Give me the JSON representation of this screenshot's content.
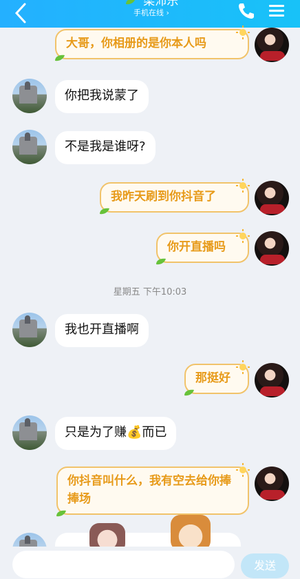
{
  "header": {
    "title": "梁沛乐",
    "subtitle": "手机在线 ›",
    "back_icon": "chevron-left-icon",
    "call_icon": "phone-icon",
    "menu_icon": "menu-icon"
  },
  "messages": [
    {
      "side": "right",
      "text": "大哥，你相册的是你本人吗"
    },
    {
      "side": "left",
      "text": "你把我说蒙了"
    },
    {
      "side": "left",
      "text": "不是我是谁呀?"
    },
    {
      "side": "right",
      "text": "我昨天刷到你抖音了"
    },
    {
      "side": "right",
      "text": "你开直播吗"
    },
    {
      "side": "timestamp",
      "text": "星期五 下午10:03"
    },
    {
      "side": "left",
      "text": "我也开直播啊"
    },
    {
      "side": "right",
      "text": "那挺好"
    },
    {
      "side": "left",
      "text": "只是为了赚💰而已"
    },
    {
      "side": "right",
      "text": "你抖音叫什么，我有空去给你捧捧场"
    }
  ],
  "composer": {
    "send_label": "发送"
  },
  "colors": {
    "header_bg": "#1eb8fd",
    "right_text": "#e79a19",
    "right_border": "#f1c36a"
  }
}
